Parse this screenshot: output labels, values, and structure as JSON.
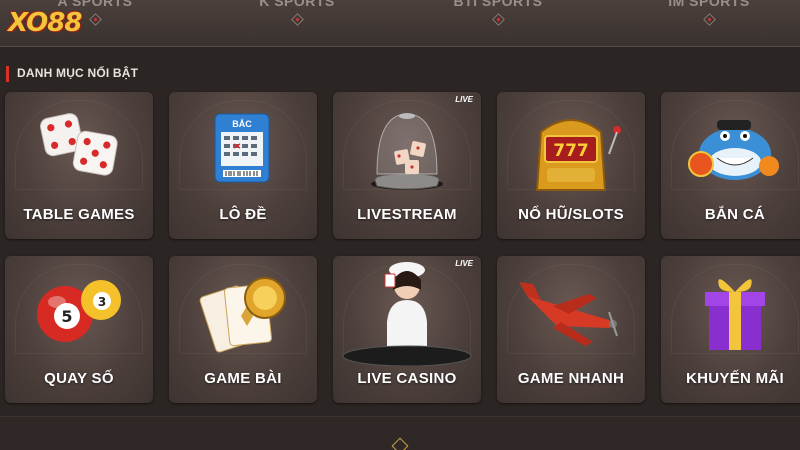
{
  "brand": {
    "logo_text": "XO88",
    "logo_color": "#f3c53b"
  },
  "nav": {
    "items": [
      {
        "label": "A SPORTS"
      },
      {
        "label": "K SPORTS"
      },
      {
        "label": "BTI SPORTS"
      },
      {
        "label": "IM SPORTS"
      }
    ]
  },
  "section": {
    "title": "DANH MỤC NỔI BẬT",
    "accent": "#d9302a"
  },
  "tiles": [
    {
      "label": "TABLE GAMES",
      "icon": "dice-icon"
    },
    {
      "label": "LÔ ĐỀ",
      "icon": "lottery-ticket-icon",
      "ticket_header": "BẮC"
    },
    {
      "label": "LIVESTREAM",
      "icon": "dice-dome-icon",
      "badge": "LIVE"
    },
    {
      "label": "NỔ HŨ/SLOTS",
      "icon": "slot-machine-icon",
      "slot_value": "777"
    },
    {
      "label": "BẮN CÁ",
      "icon": "shark-icon"
    },
    {
      "label": "QUAY SỐ",
      "icon": "lottery-balls-icon",
      "ball_1": "5",
      "ball_2": "3"
    },
    {
      "label": "GAME BÀI",
      "icon": "cards-chip-icon"
    },
    {
      "label": "LIVE CASINO",
      "icon": "dealer-icon",
      "badge": "LIVE"
    },
    {
      "label": "GAME NHANH",
      "icon": "airplane-icon"
    },
    {
      "label": "KHUYẾN MÃI",
      "icon": "gift-box-icon"
    }
  ]
}
